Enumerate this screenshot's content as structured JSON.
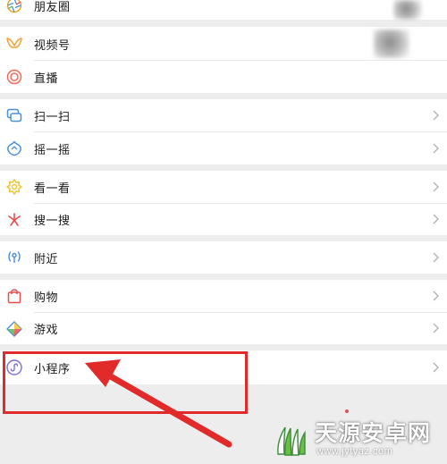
{
  "menu": {
    "moments": {
      "label": "朋友圈",
      "icon": "moments-icon"
    },
    "channels": {
      "label": "视频号",
      "icon": "channels-icon"
    },
    "live": {
      "label": "直播",
      "icon": "live-icon"
    },
    "scan": {
      "label": "扫一扫",
      "icon": "scan-icon"
    },
    "shake": {
      "label": "摇一摇",
      "icon": "shake-icon"
    },
    "top_stories": {
      "label": "看一看",
      "icon": "top-stories-icon"
    },
    "search": {
      "label": "搜一搜",
      "icon": "search-icon"
    },
    "nearby": {
      "label": "附近",
      "icon": "nearby-icon"
    },
    "shopping": {
      "label": "购物",
      "icon": "shopping-bag-icon"
    },
    "games": {
      "label": "游戏",
      "icon": "games-icon"
    },
    "mini_programs": {
      "label": "小程序",
      "icon": "mini-program-icon"
    }
  },
  "annotation": {
    "color": "#e12a2a",
    "highlighted_item": "小程序"
  },
  "watermark": {
    "title": "天源安卓网",
    "url": "www.jytyaz.com"
  },
  "colors": {
    "background": "#ededed",
    "row": "#ffffff",
    "chevron": "#b2b2b2",
    "text": "#1a1a1a"
  }
}
